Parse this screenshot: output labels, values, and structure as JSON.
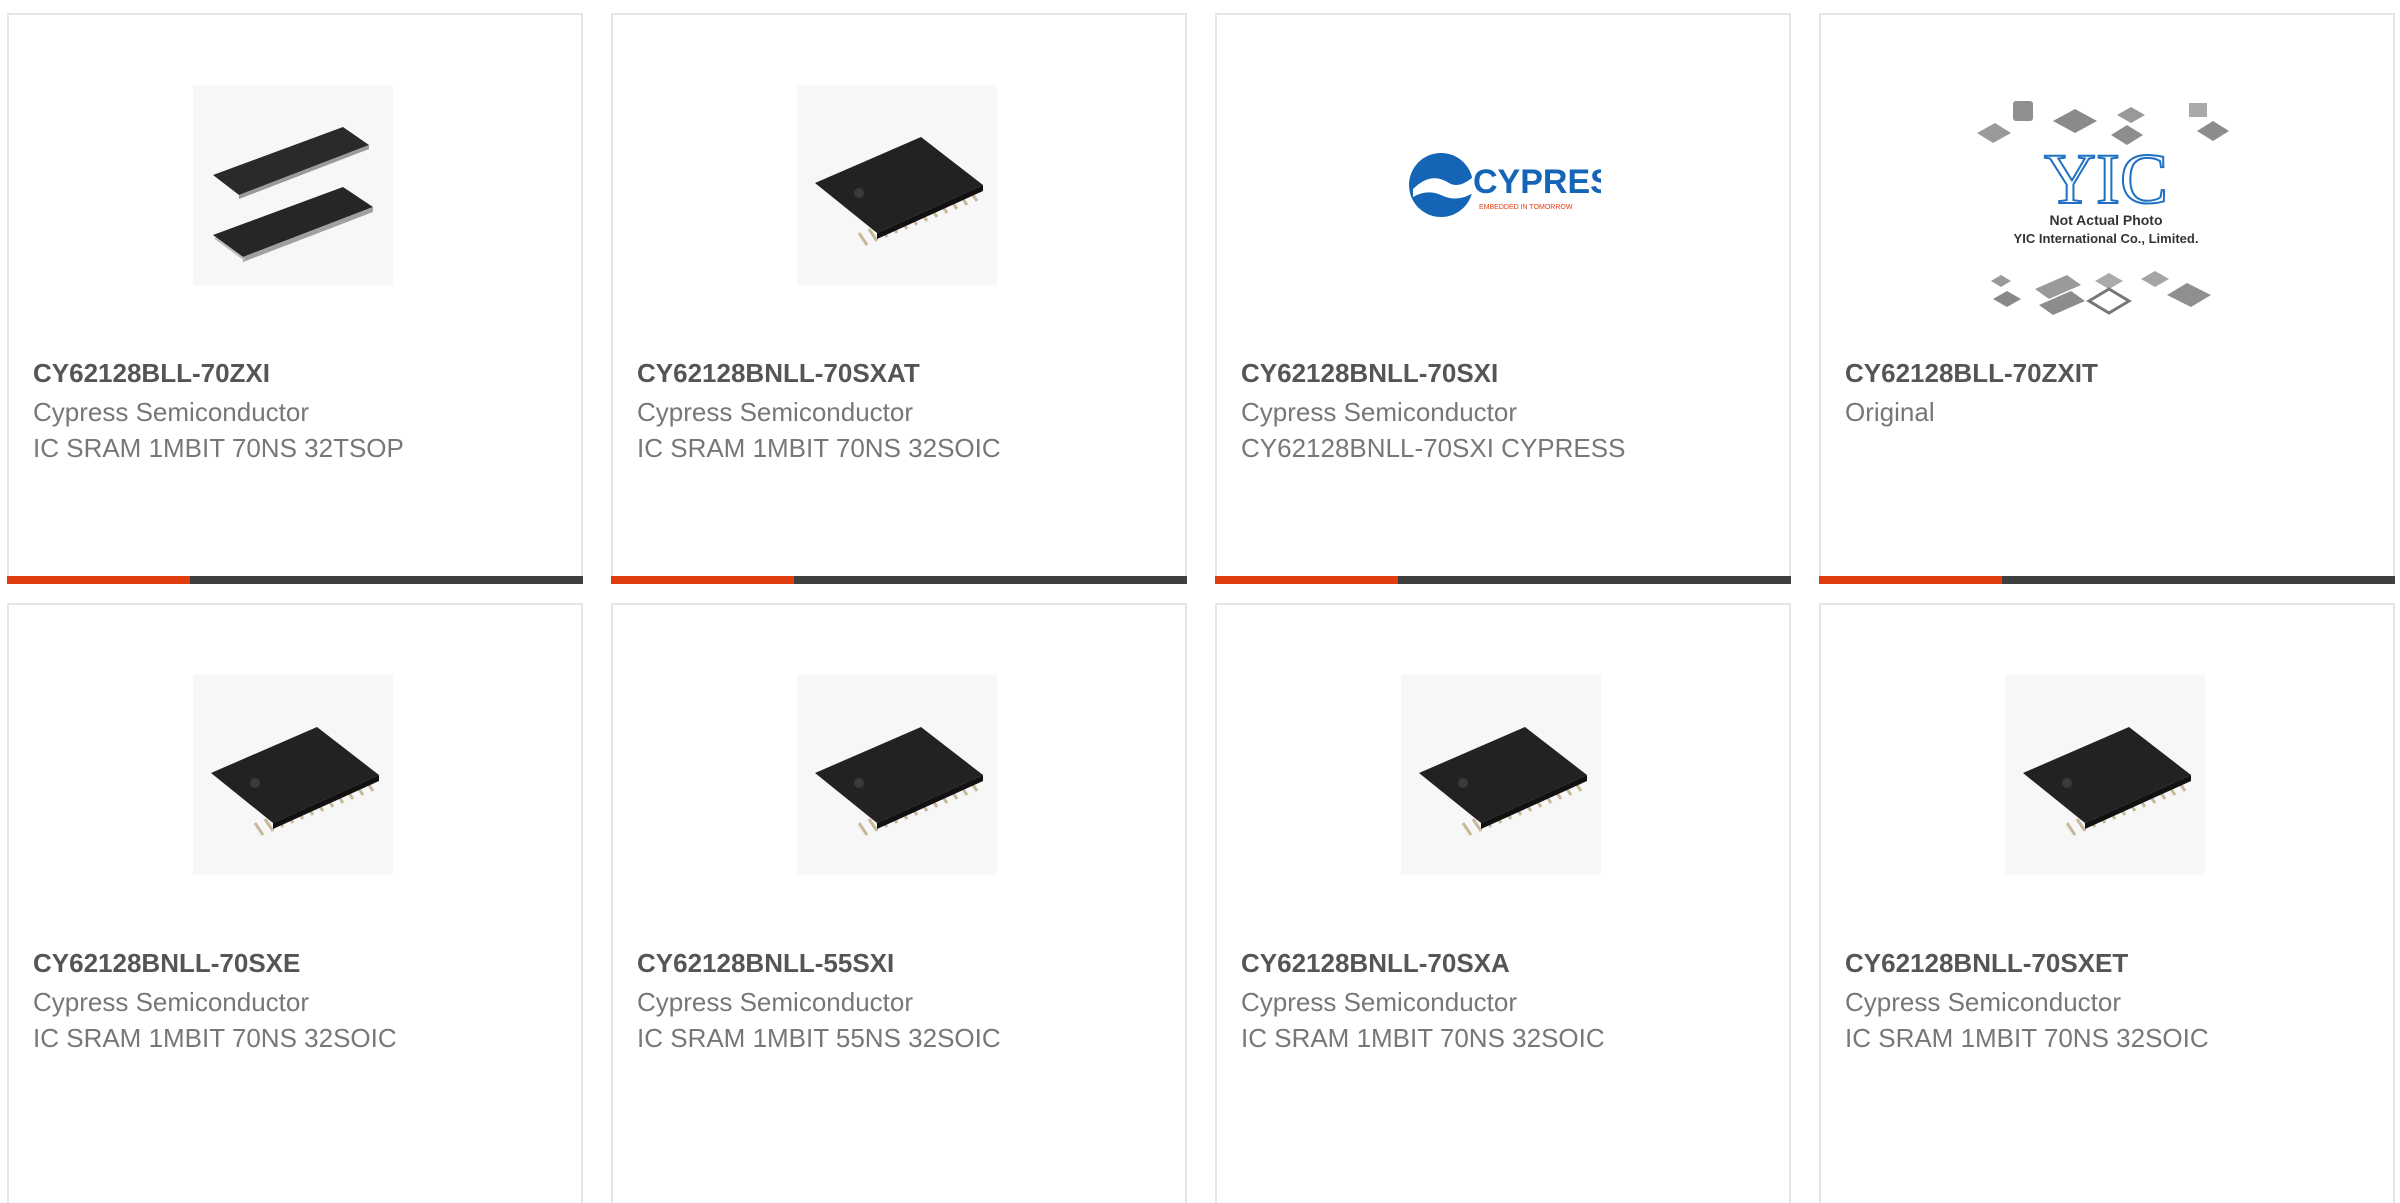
{
  "colors": {
    "accent": "#e03c10",
    "bar_dark": "#3f3f3f",
    "title_text": "#555555",
    "body_text": "#777777",
    "card_border": "#e6e6e6"
  },
  "products": [
    {
      "part": "CY62128BLL-70ZXI",
      "manufacturer": "Cypress Semiconductor",
      "description": "IC SRAM 1MBIT 70NS 32TSOP",
      "image": "tsop-chip-image"
    },
    {
      "part": "CY62128BNLL-70SXAT",
      "manufacturer": "Cypress Semiconductor",
      "description": "IC SRAM 1MBIT 70NS 32SOIC",
      "image": "soic-chip-image"
    },
    {
      "part": "CY62128BNLL-70SXI",
      "manufacturer": "Cypress Semiconductor",
      "description": "CY62128BNLL-70SXI CYPRESS",
      "image": "cypress-logo-image",
      "logo": {
        "brand": "CYPRESS",
        "tagline": "EMBEDDED IN TOMORROW"
      }
    },
    {
      "part": "CY62128BLL-70ZXIT",
      "manufacturer": "Original",
      "description": "",
      "image": "placeholder-image",
      "placeholder": {
        "logo": "YIC",
        "line1": "Not Actual Photo",
        "line2": "YIC International Co., Limited."
      }
    },
    {
      "part": "CY62128BNLL-70SXE",
      "manufacturer": "Cypress Semiconductor",
      "description": "IC SRAM 1MBIT 70NS 32SOIC",
      "image": "soic-chip-image"
    },
    {
      "part": "CY62128BNLL-55SXI",
      "manufacturer": "Cypress Semiconductor",
      "description": "IC SRAM 1MBIT 55NS 32SOIC",
      "image": "soic-chip-image"
    },
    {
      "part": "CY62128BNLL-70SXA",
      "manufacturer": "Cypress Semiconductor",
      "description": "IC SRAM 1MBIT 70NS 32SOIC",
      "image": "soic-chip-image"
    },
    {
      "part": "CY62128BNLL-70SXET",
      "manufacturer": "Cypress Semiconductor",
      "description": "IC SRAM 1MBIT 70NS 32SOIC",
      "image": "soic-chip-image"
    }
  ]
}
